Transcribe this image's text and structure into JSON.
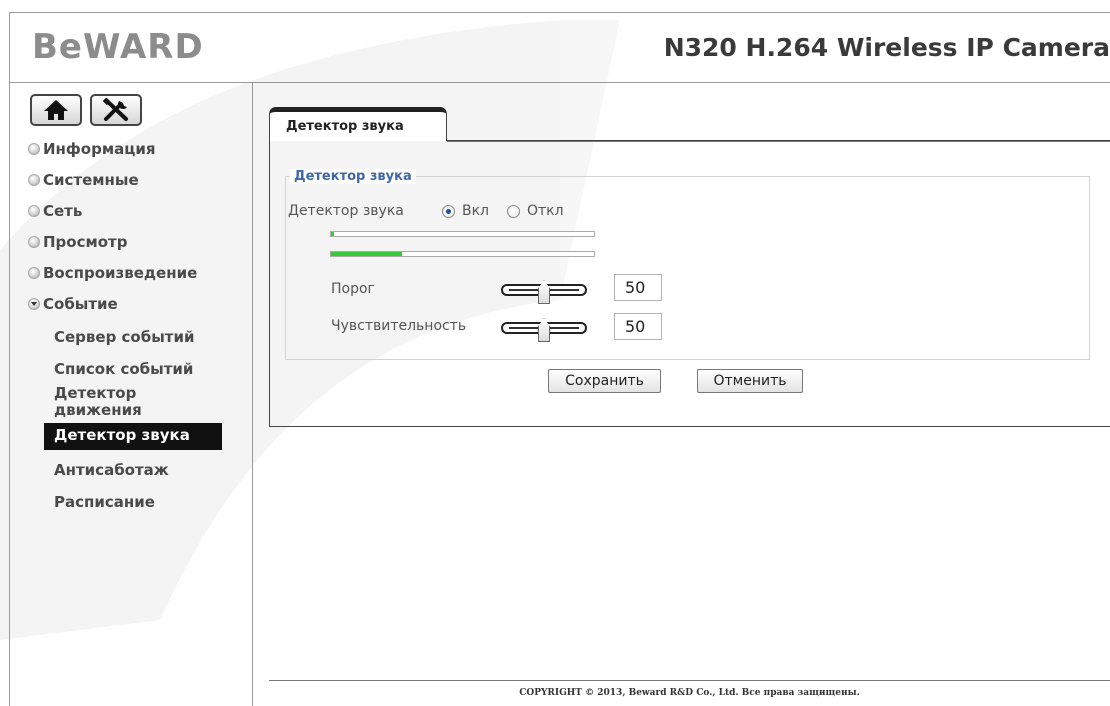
{
  "header": {
    "logo": "BeWARD",
    "product_title": "N320 H.264 Wireless IP Camera"
  },
  "toolbar": {
    "home_icon": "home-icon",
    "settings_icon": "tools-icon"
  },
  "sidebar": {
    "items": [
      {
        "label": "Информация",
        "expanded": false
      },
      {
        "label": "Системные",
        "expanded": false
      },
      {
        "label": "Сеть",
        "expanded": false
      },
      {
        "label": "Просмотр",
        "expanded": false
      },
      {
        "label": "Воспроизведение",
        "expanded": false
      },
      {
        "label": "Событие",
        "expanded": true
      }
    ],
    "subitems": [
      {
        "label": "Сервер событий"
      },
      {
        "label": "Список событий"
      },
      {
        "label": "Детектор движения"
      },
      {
        "label": "Детектор звука",
        "active": true
      },
      {
        "label": "Антисаботаж"
      },
      {
        "label": "Расписание"
      }
    ]
  },
  "main": {
    "tab_label": "Детектор звука",
    "fieldset_legend": "Детектор звука",
    "detector_label": "Детектор звука",
    "on_label": "Вкл",
    "off_label": "Откл",
    "selected": "Вкл",
    "level_1_fraction": 0.01,
    "level_2_fraction": 0.27,
    "threshold_label": "Порог",
    "threshold_value": "50",
    "sensitivity_label": "Чувствительность",
    "sensitivity_value": "50",
    "save_label": "Сохранить",
    "cancel_label": "Отменить"
  },
  "footer": {
    "copyright": "COPYRIGHT © 2013, Beward R&D Co., Ltd. Все права защищены."
  },
  "colors": {
    "accent_blue": "#3f67a8",
    "level_green": "#33cc33",
    "active_bg": "#111111"
  }
}
